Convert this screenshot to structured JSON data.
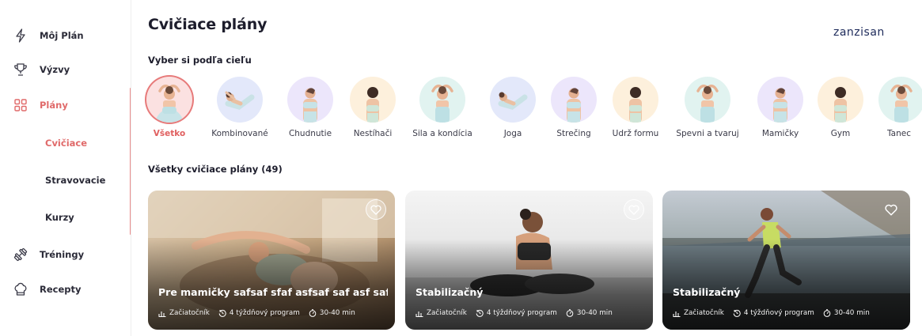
{
  "sidebar": {
    "items": [
      {
        "label": "Môj Plán",
        "icon": "lightning-icon"
      },
      {
        "label": "Výzvy",
        "icon": "trophy-icon"
      },
      {
        "label": "Plány",
        "icon": "grid-icon"
      },
      {
        "label": "Tréningy",
        "icon": "dumbbell-icon"
      },
      {
        "label": "Recepty",
        "icon": "chef-hat-icon"
      }
    ],
    "sub_items": [
      {
        "label": "Cvičiace"
      },
      {
        "label": "Stravovacie"
      },
      {
        "label": "Kurzy"
      }
    ],
    "active_item": "Plány",
    "active_sub_item": "Cvičiace"
  },
  "header": {
    "title": "Cvičiace plány",
    "brand": "zanzisan"
  },
  "goals": {
    "title": "Vyber si podľa cieľu",
    "categories": [
      {
        "label": "Všetko",
        "active": true
      },
      {
        "label": "Kombinované"
      },
      {
        "label": "Chudnutie"
      },
      {
        "label": "Nestíhači"
      },
      {
        "label": "Sila a kondícia"
      },
      {
        "label": "Joga"
      },
      {
        "label": "Strečing"
      },
      {
        "label": "Udrž formu"
      },
      {
        "label": "Spevni a tvaruj"
      },
      {
        "label": "Mamičky"
      },
      {
        "label": "Gym"
      },
      {
        "label": "Tanec"
      }
    ]
  },
  "plans": {
    "title": "Všetky cvičiace plány (49)",
    "cards": [
      {
        "title": "Pre mamičky safsaf sfaf asfsaf saf asf safs",
        "level": "Začiatočník",
        "duration": "4 týždňový program",
        "time": "30-40 min"
      },
      {
        "title": "Stabilizačný",
        "level": "Začiatočník",
        "duration": "4 týždňový program",
        "time": "30-40 min"
      },
      {
        "title": "Stabilizačný",
        "level": "Začiatočník",
        "duration": "4 týždňový program",
        "time": "30-40 min"
      }
    ]
  },
  "colors": {
    "accent": "#e06a6a",
    "text": "#1d1d2c",
    "brand": "#1d2a5a"
  }
}
